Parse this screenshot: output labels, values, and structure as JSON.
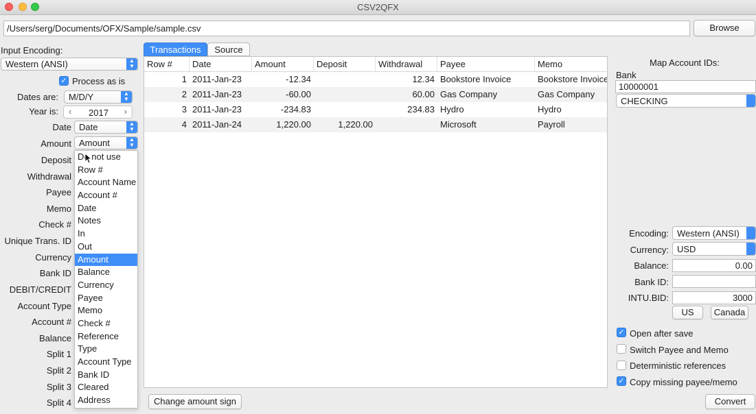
{
  "window": {
    "title": "CSV2QFX"
  },
  "file": {
    "path": "/Users/serg/Documents/OFX/Sample/sample.csv",
    "browse_label": "Browse"
  },
  "left": {
    "input_encoding_label": "Input Encoding:",
    "input_encoding_value": "Western (ANSI)",
    "process_as_is_label": "Process as is",
    "process_as_is_checked": true,
    "dates_are_label": "Dates are:",
    "dates_are_value": "M/D/Y",
    "year_is_label": "Year is:",
    "year_value": "2017",
    "year_prev": "‹",
    "year_next": "›",
    "mappings": [
      {
        "label": "Date",
        "value": "Date"
      },
      {
        "label": "Amount",
        "value": "Amount"
      },
      {
        "label": "Deposit",
        "value": ""
      },
      {
        "label": "Withdrawal",
        "value": ""
      },
      {
        "label": "Payee",
        "value": ""
      },
      {
        "label": "Memo",
        "value": ""
      },
      {
        "label": "Check #",
        "value": ""
      },
      {
        "label": "Unique Trans. ID",
        "value": ""
      },
      {
        "label": "Currency",
        "value": ""
      },
      {
        "label": "Bank ID",
        "value": ""
      },
      {
        "label": "DEBIT/CREDIT",
        "value": ""
      },
      {
        "label": "Account Type",
        "value": ""
      },
      {
        "label": "Account #",
        "value": ""
      },
      {
        "label": "Balance",
        "value": ""
      },
      {
        "label": "Split 1",
        "value": ""
      },
      {
        "label": "Split 2",
        "value": ""
      },
      {
        "label": "Split 3",
        "value": ""
      },
      {
        "label": "Split 4",
        "value": ""
      }
    ]
  },
  "dropdown": {
    "options": [
      "Do not use",
      "Row #",
      "Account Name",
      "Account #",
      "Date",
      "Notes",
      "In",
      "Out",
      "Amount",
      "Balance",
      "Currency",
      "Payee",
      "Memo",
      "Check #",
      "Reference",
      "Type",
      "Account Type",
      "Bank ID",
      "Cleared",
      "Address"
    ],
    "selected": "Amount"
  },
  "tabs": [
    {
      "label": "Transactions",
      "active": true
    },
    {
      "label": "Source",
      "active": false
    }
  ],
  "table": {
    "columns": [
      "Row #",
      "Date",
      "Amount",
      "Deposit",
      "Withdrawal",
      "Payee",
      "Memo"
    ],
    "rows": [
      [
        "1",
        "2011-Jan-23",
        "-12.34",
        "",
        "12.34",
        "Bookstore Invoice",
        "Bookstore Invoice"
      ],
      [
        "2",
        "2011-Jan-23",
        "-60.00",
        "",
        "60.00",
        "Gas Company",
        "Gas Company"
      ],
      [
        "3",
        "2011-Jan-23",
        "-234.83",
        "",
        "234.83",
        "Hydro",
        "Hydro"
      ],
      [
        "4",
        "2011-Jan-24",
        "1,220.00",
        "1,220.00",
        "",
        "Microsoft",
        "Payroll"
      ]
    ]
  },
  "change_sign_label": "Change amount sign",
  "right": {
    "map_account_ids_label": "Map Account IDs:",
    "bank_label": "Bank",
    "bank_value": "10000001",
    "account_type_value": "CHECKING",
    "encoding_label": "Encoding:",
    "encoding_value": "Western (ANSI)",
    "currency_label": "Currency:",
    "currency_value": "USD",
    "balance_label": "Balance:",
    "balance_value": "0.00",
    "bank_id_label": "Bank ID:",
    "bank_id_value": "",
    "intu_bid_label": "INTU.BID:",
    "intu_bid_value": "3000",
    "us_label": "US",
    "canada_label": "Canada",
    "options": [
      {
        "label": "Open after save",
        "checked": true
      },
      {
        "label": "Switch Payee and Memo",
        "checked": false
      },
      {
        "label": "Deterministic references",
        "checked": false
      },
      {
        "label": "Copy missing payee/memo",
        "checked": true
      }
    ],
    "convert_label": "Convert"
  },
  "colors": {
    "accent": "#3f8ef7",
    "window_bg": "#ececec",
    "row_alt": "#f2f2f2"
  }
}
